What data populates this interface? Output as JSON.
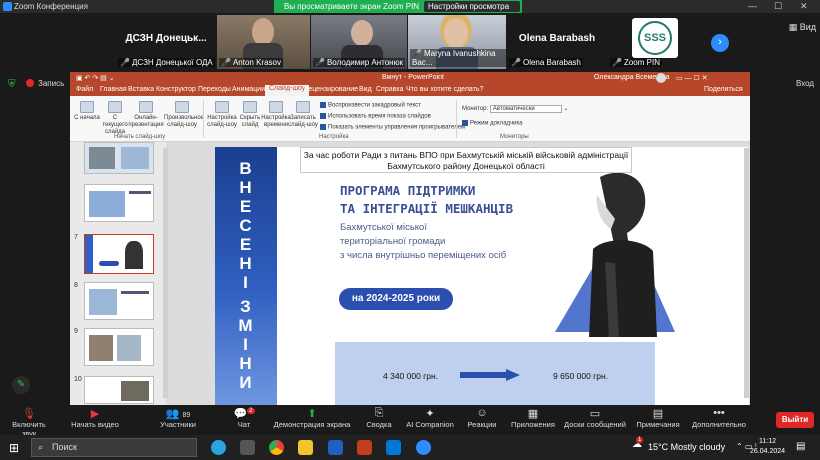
{
  "window": {
    "title": "Zoom Конференция"
  },
  "sharebar": {
    "message": "Вы просматриваете экран Zoom PIN",
    "view_options": "Настройки просмотра"
  },
  "gallery": {
    "tiles": [
      {
        "name": "ДСЗН Донецької ОДА",
        "big_label": "ДСЗН Донецьк..."
      },
      {
        "name": "Anton Krasov"
      },
      {
        "name": "Володимир Антонюк"
      },
      {
        "name": "Maryna Ivanushkina Вас..."
      },
      {
        "name": "Olena Barabash",
        "big_label": "Olena Barabash"
      },
      {
        "name": "Zoom PIN"
      }
    ],
    "view_label": "Вид",
    "exit_label": "Вход",
    "record_label": "Запись"
  },
  "ppt": {
    "title": "Вмнут - PowerPoint",
    "user": "Олександра Всеменіна",
    "tabs": [
      "Файл",
      "Главная",
      "Вставка",
      "Конструктор",
      "Переходы",
      "Анимации",
      "Слайд-шоу",
      "Рецензирование",
      "Вид",
      "Справка",
      "Что вы хотите сделать?"
    ],
    "share_label": "Поделиться",
    "ribbon": {
      "buttons": [
        "С начала",
        "С текущего слайда",
        "Онлайн-презентация",
        "Произвольное слайд-шоу",
        "Настройка слайд-шоу",
        "Скрыть слайд",
        "Настройка времени",
        "Записать слайд-шоу"
      ],
      "checks": [
        "Воспроизвести закадровый текст",
        "Использовать время показа слайдов",
        "Показать элементы управления проигрывателем"
      ],
      "monitor_label": "Монитор:",
      "monitor_value": "Автоматически",
      "presenter_check": "Режим докладчика",
      "groups": [
        "Начать слайд-шоу",
        "Настройка",
        "Мониторы"
      ]
    },
    "thumb_numbers": [
      "7",
      "8",
      "9",
      "10"
    ]
  },
  "slide": {
    "caption": "За час роботи Ради з питань ВПО при Бахмутській міській військовій адміністрації Бахмутського району Донецької області",
    "vertical_text_1": "ВНЕСЕНІ",
    "vertical_text_2": "ЗМІНИ",
    "program_title_1": "ПРОГРАМА ПІДТРИМКИ",
    "program_title_2": "ТА ІНТЕГРАЦІЇ МЕШКАНЦІВ",
    "subtitle_1": "Бахмутської міської",
    "subtitle_2": "територіальної громади",
    "subtitle_3": "з числа внутрішньо переміщених осіб",
    "years": "на 2024-2025 роки",
    "amount_before": "4 340 000 грн.",
    "amount_after": "9 650 000 грн."
  },
  "controls": {
    "items": [
      "Включить звук",
      "Начать видео",
      "Участники",
      "Чат",
      "Демонстрация экрана",
      "Сводка",
      "AI Companion",
      "Реакции",
      "Приложения",
      "Доски сообщений",
      "Примечания",
      "Дополнительно"
    ],
    "participants_count": "89",
    "chat_badge": "2",
    "leave_label": "Выйти"
  },
  "taskbar": {
    "search_placeholder": "Поиск",
    "temperature": "15°C",
    "weather": "Mostly cloudy",
    "time": "11:12",
    "date": "26.04.2024",
    "notification_count": "1"
  }
}
